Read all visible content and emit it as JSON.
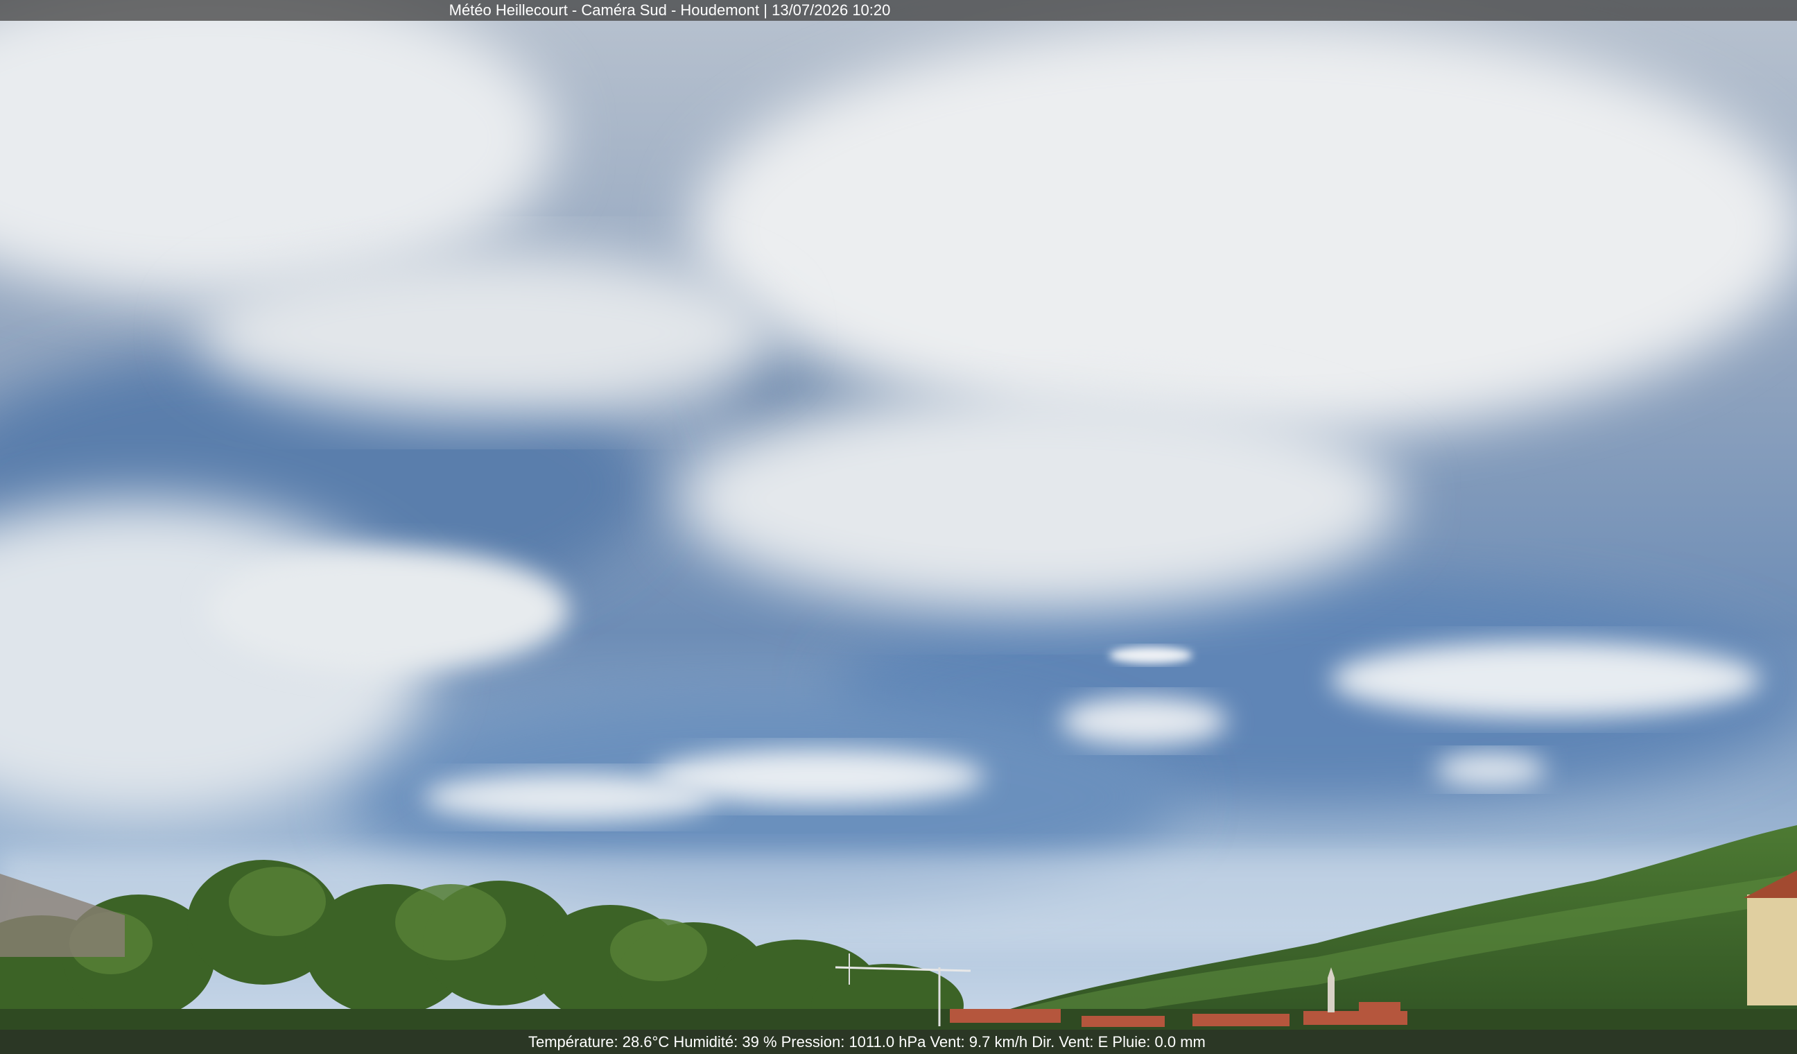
{
  "header": {
    "title": "Météo Heillecourt - Caméra Sud - Houdemont | 13/07/2026 10:20"
  },
  "weather": {
    "text": "Température: 28.6°C  Humidité: 39 % Pression: 1011.0 hPa Vent: 9.7 km/h Dir. Vent: E Pluie: 0.0 mm"
  },
  "colors": {
    "sky_top": "#c7cfd8",
    "sky_blue": "#5f82b0",
    "horizon": "#b9cde0",
    "trees": "#3f6a2c",
    "roofs": "#b5563d"
  }
}
